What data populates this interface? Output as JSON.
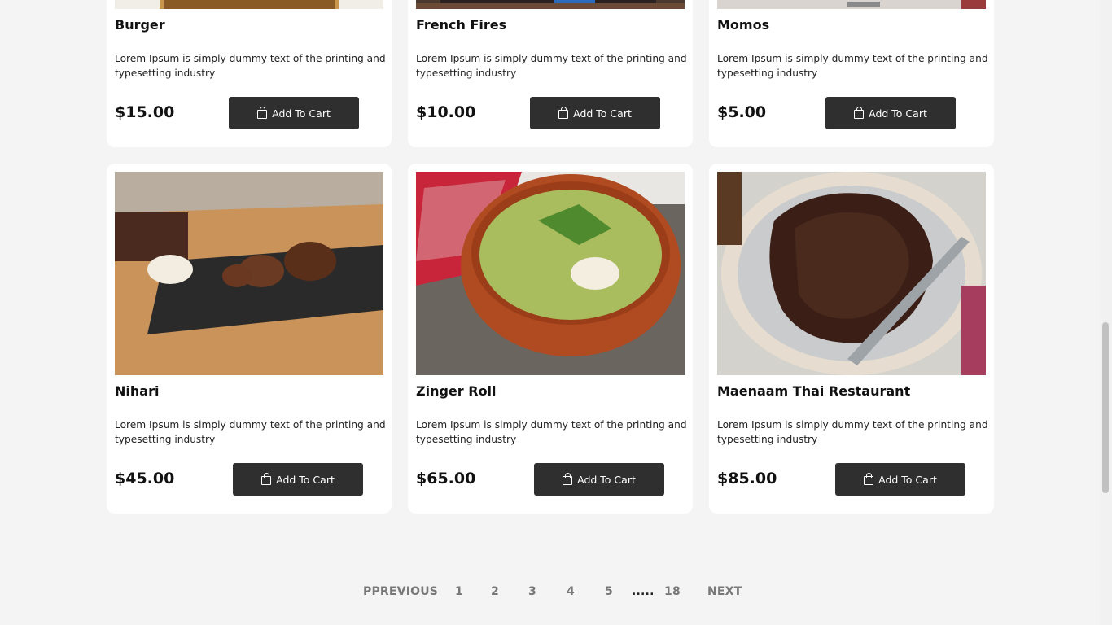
{
  "products_top": [
    {
      "name": "Burger",
      "description": "Lorem Ipsum is simply dummy text of the printing and typesetting industry",
      "price": "$15.00",
      "button": "Add To Cart"
    },
    {
      "name": "French Fires",
      "description": "Lorem Ipsum is simply dummy text of the printing and typesetting industry",
      "price": "$10.00",
      "button": "Add To Cart"
    },
    {
      "name": "Momos",
      "description": "Lorem Ipsum is simply dummy text of the printing and typesetting industry",
      "price": "$5.00",
      "button": "Add To Cart"
    }
  ],
  "products_bottom": [
    {
      "name": "Nihari",
      "description": "Lorem Ipsum is simply dummy text of the printing and typesetting industry",
      "price": "$45.00",
      "button": "Add To Cart"
    },
    {
      "name": "Zinger Roll",
      "description": "Lorem Ipsum is simply dummy text of the printing and typesetting industry",
      "price": "$65.00",
      "button": "Add To Cart"
    },
    {
      "name": "Maenaam Thai Restaurant",
      "description": "Lorem Ipsum is simply dummy text of the printing and typesetting industry",
      "price": "$85.00",
      "button": "Add To Cart"
    }
  ],
  "pagination": {
    "previous": "PPREVIOUS",
    "pages": [
      "1",
      "2",
      "3",
      "4",
      "5"
    ],
    "ellipsis": ".....",
    "last": "18",
    "next": "NEXT"
  },
  "icons": {
    "cart_button": "shopping-bag-icon"
  },
  "colors": {
    "button_bg": "#2f2f2f",
    "page_bg": "#f4f4f4",
    "card_bg": "#ffffff",
    "pager_text": "#777777"
  }
}
